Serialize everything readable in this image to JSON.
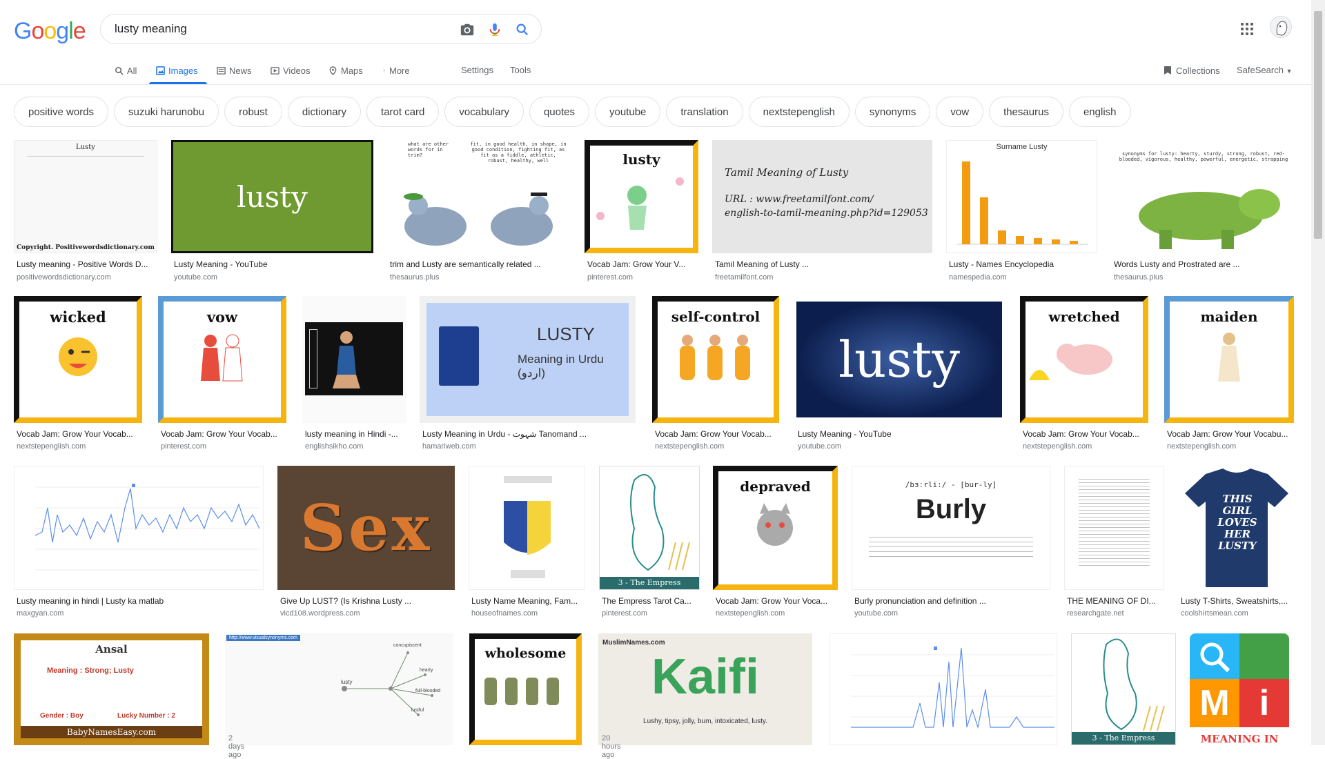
{
  "logo": {
    "letters": [
      "G",
      "o",
      "o",
      "g",
      "l",
      "e"
    ]
  },
  "search": {
    "query": "lusty meaning"
  },
  "nav": {
    "tabs": [
      {
        "label": "All"
      },
      {
        "label": "Images"
      },
      {
        "label": "News"
      },
      {
        "label": "Videos"
      },
      {
        "label": "Maps"
      },
      {
        "label": "More"
      }
    ],
    "settings": "Settings",
    "tools": "Tools",
    "collections": "Collections",
    "safesearch": "SafeSearch"
  },
  "chips": [
    "positive words",
    "suzuki harunobu",
    "robust",
    "dictionary",
    "tarot card",
    "vocabulary",
    "quotes",
    "youtube",
    "translation",
    "nextstepenglish",
    "synonyms",
    "vow",
    "thesaurus",
    "english"
  ],
  "row1": [
    {
      "title": "Lusty meaning - Positive Words D...",
      "site": "positivewordsdictionary.com",
      "img_title": "Lusty",
      "img_text": "Copyright.  Positivewordsdictionary.com"
    },
    {
      "title": "Lusty Meaning - YouTube",
      "site": "youtube.com",
      "img_text": "lusty"
    },
    {
      "title": "trim and Lusty are semantically related ...",
      "site": "thesaurus.plus",
      "img_text_left": "what are other words for in trim?",
      "img_text_right": "fit, in good health, in shape, in good condition, fighting fit, as fit as a fiddle, athletic, robust, healthy, well"
    },
    {
      "title": "Vocab Jam: Grow Your V...",
      "site": "pinterest.com",
      "img_text": "lusty"
    },
    {
      "title": "Tamil Meaning of Lusty ...",
      "site": "freetamilfont.com",
      "img_line1": "Tamil Meaning of Lusty",
      "img_line2": "URL : www.freetamilfont.com/",
      "img_line3": "english-to-tamil-meaning.php?id=129053"
    },
    {
      "title": "Lusty - Names Encyclopedia",
      "site": "namespedia.com",
      "img_title": "Surname Lusty"
    },
    {
      "title": "Words Lusty and Prostrated are ...",
      "site": "thesaurus.plus",
      "img_text": "synonyms for lusty: hearty, sturdy, strong, robust, red-blooded, vigorous, healthy, powerful, energetic, strapping"
    }
  ],
  "row2": [
    {
      "title": "Vocab Jam: Grow Your Vocab...",
      "site": "nextstepenglish.com",
      "img_text": "wicked"
    },
    {
      "title": "Vocab Jam: Grow Your Vocab...",
      "site": "pinterest.com",
      "img_text": "vow"
    },
    {
      "title": "lusty meaning in Hindi -...",
      "site": "englishsikho.com"
    },
    {
      "title": "Lusty Meaning in Urdu - شہوت Tanomand ...",
      "site": "hamariweb.com",
      "img_line1": "LUSTY",
      "img_line2": "Meaning in Urdu (اردو)"
    },
    {
      "title": "Vocab Jam: Grow Your Vocab...",
      "site": "nextstepenglish.com",
      "img_text": "self-control"
    },
    {
      "title": "Lusty Meaning - YouTube",
      "site": "youtube.com",
      "img_text": "lusty"
    },
    {
      "title": "Vocab Jam: Grow Your Vocab...",
      "site": "nextstepenglish.com",
      "img_text": "wretched"
    },
    {
      "title": "Vocab Jam: Grow Your Vocabu...",
      "site": "nextstepenglish.com",
      "img_text": "maiden"
    }
  ],
  "row3": [
    {
      "title": "Lusty meaning in hindi | Lusty ka matlab",
      "site": "maxgyan.com"
    },
    {
      "title": "Give Up LUST? (Is Krishna Lusty ...",
      "site": "vicd108.wordpress.com",
      "img_text": "Sex"
    },
    {
      "title": "Lusty Name Meaning, Fam...",
      "site": "houseofnames.com"
    },
    {
      "title": "The Empress Tarot Ca...",
      "site": "pinterest.com",
      "img_text": "3 - The Empress"
    },
    {
      "title": "Vocab Jam: Grow Your Voca...",
      "site": "nextstepenglish.com",
      "img_text": "depraved"
    },
    {
      "title": "Burly pronunciation and definition ...",
      "site": "youtube.com",
      "img_text": "Burly",
      "img_sub": "/bɜːrli:/ - [bur-ly]"
    },
    {
      "title": "THE MEANING OF DI...",
      "site": "researchgate.net"
    },
    {
      "title": "Lusty T-Shirts, Sweatshirts,...",
      "site": "coolshirtsmean.com",
      "img_text": "THIS GIRL LOVES HER LUSTY"
    }
  ],
  "row4": [
    {
      "img_text": "Ansal",
      "img_sub": "Meaning : Strong; Lusty",
      "img_foot": "BabyNamesEasy.com",
      "img_gender": "Gender : Boy",
      "img_lucky": "Lucky Number : 2"
    },
    {
      "badge": "2 days ago",
      "img_url": "http://www.visualsynonyms.com",
      "img_words": [
        "concupiscent",
        "hearty",
        "lusty",
        "full-blooded",
        "lustful"
      ]
    },
    {
      "img_text": "wholesome"
    },
    {
      "badge": "20 hours ago",
      "img_text": "Kaifi",
      "img_brand": "MuslimNames.com",
      "img_sub": "Lushy, tipsy, jolly, bum, intoxicated, lusty."
    },
    {},
    {
      "img_text": "3 - The Empress"
    },
    {
      "img_text": "MEANING IN"
    }
  ]
}
